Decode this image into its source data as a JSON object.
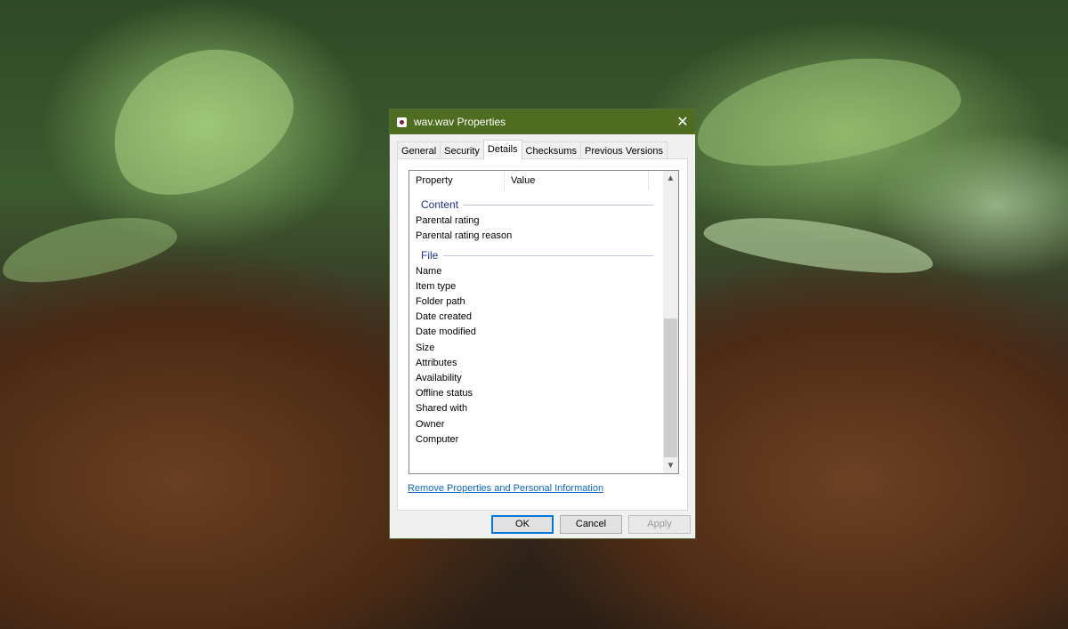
{
  "window": {
    "title": "wav.wav Properties",
    "close_glyph": "✕",
    "icon": "audio-file-icon"
  },
  "tabs": [
    {
      "label": "General",
      "active": false
    },
    {
      "label": "Security",
      "active": false
    },
    {
      "label": "Details",
      "active": true
    },
    {
      "label": "Checksums",
      "active": false
    },
    {
      "label": "Previous Versions",
      "active": false
    }
  ],
  "list": {
    "columns": {
      "property": "Property",
      "value": "Value"
    },
    "groups": [
      {
        "label": "Content",
        "rows": [
          "Parental rating",
          "Parental rating reason"
        ]
      },
      {
        "label": "File",
        "rows": [
          "Name",
          "Item type",
          "Folder path",
          "Date created",
          "Date modified",
          "Size",
          "Attributes",
          "Availability",
          "Offline status",
          "Shared with",
          "Owner",
          "Computer"
        ]
      }
    ],
    "scroll_up": "▲",
    "scroll_down": "▼"
  },
  "link": "Remove Properties and Personal Information",
  "buttons": {
    "ok": "OK",
    "cancel": "Cancel",
    "apply": "Apply"
  },
  "colors": {
    "titlebar": "#4e6d21",
    "link": "#0b66c2",
    "group": "#1e3287",
    "focus": "#0078d7"
  }
}
